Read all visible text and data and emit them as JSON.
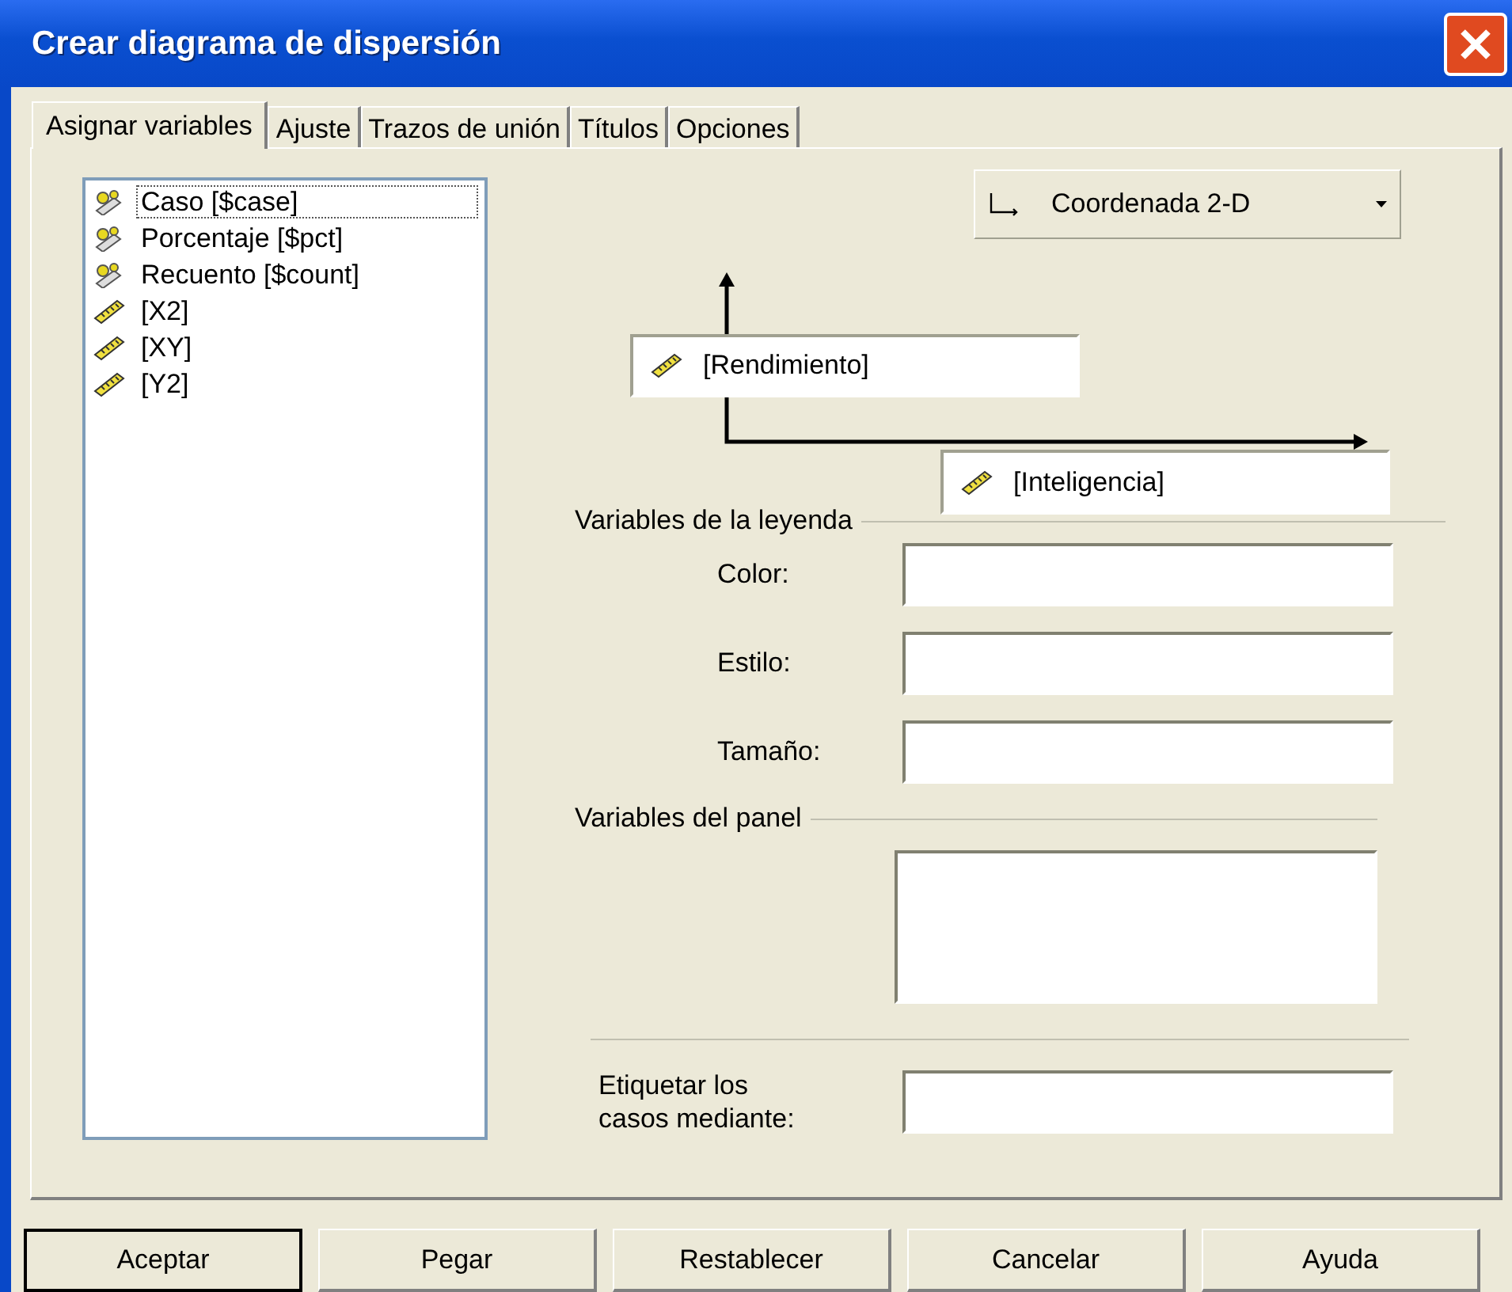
{
  "window": {
    "title": "Crear diagrama de dispersión"
  },
  "tabs": [
    {
      "label": "Asignar variables",
      "selected": true
    },
    {
      "label": "Ajuste",
      "selected": false
    },
    {
      "label": "Trazos de unión",
      "selected": false
    },
    {
      "label": "Títulos",
      "selected": false
    },
    {
      "label": "Opciones",
      "selected": false
    }
  ],
  "variables": [
    {
      "name": "Caso [$case]",
      "kind": "special",
      "selected": true
    },
    {
      "name": "Porcentaje [$pct]",
      "kind": "special",
      "selected": false
    },
    {
      "name": "Recuento [$count]",
      "kind": "special",
      "selected": false
    },
    {
      "name": "[X2]",
      "kind": "scale",
      "selected": false
    },
    {
      "name": "[XY]",
      "kind": "scale",
      "selected": false
    },
    {
      "name": "[Y2]",
      "kind": "scale",
      "selected": false
    }
  ],
  "coordinate_dropdown": {
    "value": "Coordenada 2-D"
  },
  "y_axis": {
    "variable": "[Rendimiento]"
  },
  "x_axis": {
    "variable": "[Inteligencia]"
  },
  "legend": {
    "title": "Variables de la leyenda",
    "fields": [
      {
        "label": "Color:"
      },
      {
        "label": "Estilo:"
      },
      {
        "label": "Tamaño:"
      }
    ]
  },
  "panel": {
    "title": "Variables del panel"
  },
  "case_labels": {
    "label": "Etiquetar los casos mediante:"
  },
  "buttons": [
    {
      "label": "Aceptar",
      "default": true
    },
    {
      "label": "Pegar",
      "default": false
    },
    {
      "label": "Restablecer",
      "default": false
    },
    {
      "label": "Cancelar",
      "default": false
    },
    {
      "label": "Ayuda",
      "default": false
    }
  ]
}
